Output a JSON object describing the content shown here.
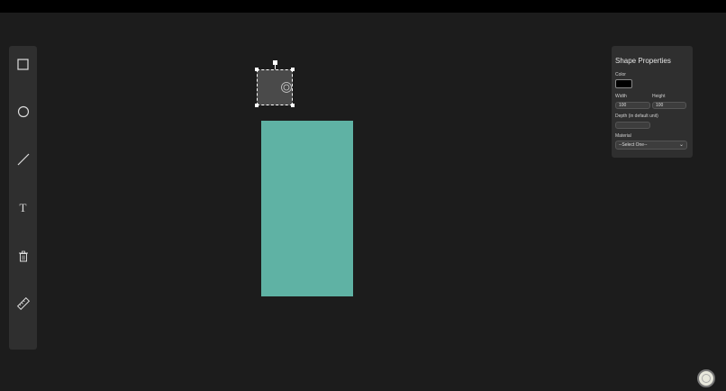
{
  "toolbar": {
    "tools": [
      {
        "icon": "rectangle-icon"
      },
      {
        "icon": "circle-icon"
      },
      {
        "icon": "line-icon"
      },
      {
        "icon": "text-icon",
        "glyph": "T"
      },
      {
        "icon": "trash-icon"
      },
      {
        "icon": "ruler-icon"
      }
    ]
  },
  "canvas": {
    "shapes": [
      {
        "kind": "rectangle",
        "color": "#4a4a4a",
        "selected": true
      },
      {
        "kind": "rectangle",
        "color": "#5fb2a4",
        "selected": false
      }
    ]
  },
  "panel": {
    "title": "Shape Properties",
    "color_label": "Color",
    "color_value": "#000000",
    "width_label": "Width",
    "width_value": "100",
    "height_label": "Height",
    "height_value": "100",
    "depth_label": "Depth (in default unit)",
    "depth_value": "",
    "material_label": "Material",
    "material_selected": "--Select One--"
  },
  "colors": {
    "background": "#1c1c1c",
    "panel": "#2f2f2f",
    "accent_teal": "#5fb2a4"
  }
}
